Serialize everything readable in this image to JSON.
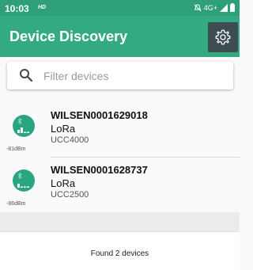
{
  "status_bar": {
    "time": "10:03",
    "hd_label": "HD",
    "network": "4G+",
    "icons": [
      "mute-icon",
      "signal-icon",
      "battery-icon"
    ]
  },
  "app_bar": {
    "title": "Device Discovery",
    "settings_icon": "gear-icon"
  },
  "search": {
    "placeholder": "Filter devices",
    "value": ""
  },
  "devices": [
    {
      "name": "WILSEN0001629018",
      "type": "LoRa",
      "model": "UCC4000",
      "rssi": "-81dBm",
      "signal_bars_filled": 2
    },
    {
      "name": "WILSEN0001628737",
      "type": "LoRa",
      "model": "UCC2500",
      "rssi": "-86dBm",
      "signal_bars_filled": 1
    }
  ],
  "footer": {
    "status": "Found 2 devices"
  },
  "colors": {
    "status_bar": "#2e9f78",
    "app_bar": "#33aa82",
    "device_icon": "#2aa582",
    "settings_button": "#3d4d52"
  }
}
